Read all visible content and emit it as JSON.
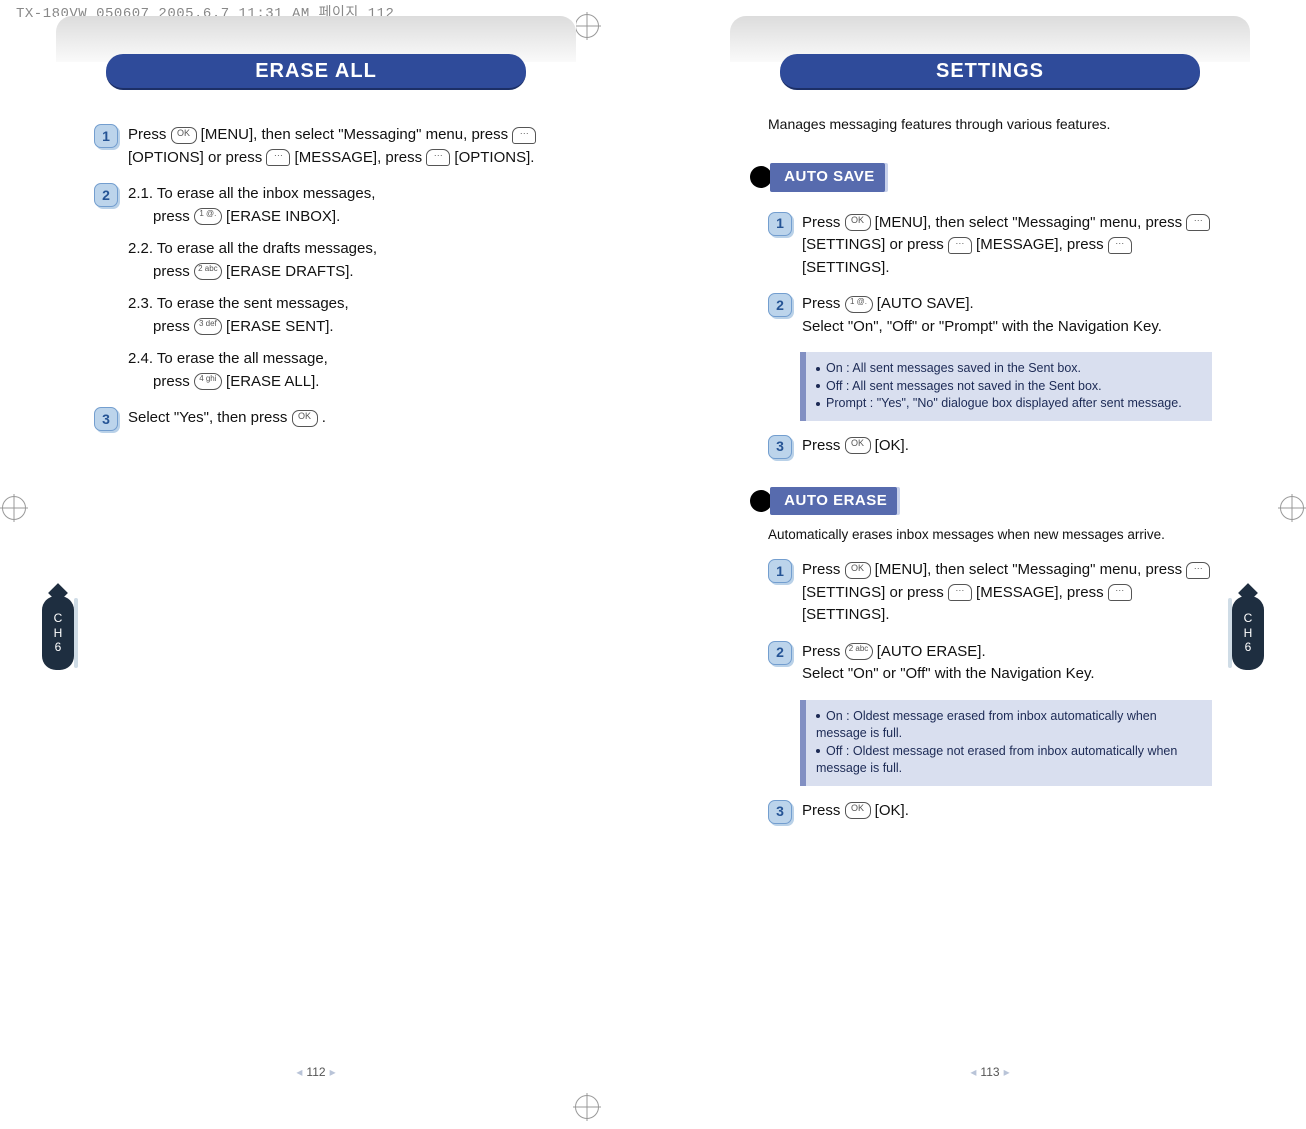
{
  "file_stamp": "TX-180VW_050607  2005.6.7 11:31 AM  페이지 112",
  "left_page": {
    "header_title": "ERASE ALL",
    "steps": {
      "s1": {
        "num": "1",
        "text_a": "Press ",
        "text_b": " [MENU], then select \"Messaging\" menu, press ",
        "text_c": " [OPTIONS] or press ",
        "text_d": " [MESSAGE], press ",
        "text_e": " [OPTIONS]."
      },
      "s2": {
        "num": "2",
        "items": [
          {
            "lead": "2.1. To erase all the inbox messages,",
            "act_a": "press ",
            "act_b": "[ERASE INBOX]."
          },
          {
            "lead": "2.2. To erase all the drafts messages,",
            "act_a": "press ",
            "act_b": "[ERASE DRAFTS]."
          },
          {
            "lead": "2.3. To erase the sent messages,",
            "act_a": "press ",
            "act_b": "[ERASE SENT]."
          },
          {
            "lead": "2.4. To erase the all message,",
            "act_a": "press ",
            "act_b": "[ERASE ALL]."
          }
        ]
      },
      "s3": {
        "num": "3",
        "text_a": "Select \"Yes\", then press ",
        "text_b": " ."
      }
    },
    "side_tab": {
      "line1": "C",
      "line2": "H",
      "line3": "6"
    },
    "page_number": "112"
  },
  "right_page": {
    "header_title": "SETTINGS",
    "lead": "Manages messaging features through various features.",
    "auto_save": {
      "chip": "AUTO SAVE",
      "s1": {
        "num": "1",
        "text_a": "Press ",
        "text_b": " [MENU], then select \"Messaging\" menu, press ",
        "text_c": " [SETTINGS] or press ",
        "text_d": " [MESSAGE], press ",
        "text_e": " [SETTINGS]."
      },
      "s2": {
        "num": "2",
        "text_a": "Press ",
        "text_b": "[AUTO SAVE].",
        "line2": "Select \"On\", \"Off\" or \"Prompt\" with the Navigation Key."
      },
      "note": {
        "l1": "On : All sent messages saved in the Sent box.",
        "l2": "Off : All sent messages not saved in the Sent box.",
        "l3": "Prompt : \"Yes\", \"No\" dialogue box displayed after sent message."
      },
      "s3": {
        "num": "3",
        "text_a": "Press ",
        "text_b": " [OK]."
      }
    },
    "auto_erase": {
      "chip": "AUTO ERASE",
      "sub": "Automatically erases inbox messages when new messages arrive.",
      "s1": {
        "num": "1",
        "text_a": "Press ",
        "text_b": " [MENU], then select \"Messaging\" menu, press ",
        "text_c": " [SETTINGS] or press ",
        "text_d": " [MESSAGE], press ",
        "text_e": " [SETTINGS]."
      },
      "s2": {
        "num": "2",
        "text_a": "Press ",
        "text_b": "[AUTO ERASE].",
        "line2": "Select \"On\" or \"Off\" with the Navigation Key."
      },
      "note": {
        "l1": "On : Oldest message erased from inbox automatically when message is full.",
        "l2": "Off : Oldest message not erased from inbox automatically when message is full."
      },
      "s3": {
        "num": "3",
        "text_a": "Press ",
        "text_b": " [OK]."
      }
    },
    "side_tab": {
      "line1": "C",
      "line2": "H",
      "line3": "6"
    },
    "page_number": "113"
  },
  "icons": {
    "ok": "OK",
    "soft_dots": "···",
    "num1": "1 @.",
    "num2": "2 abc",
    "num3": "3 def",
    "num4": "4 ghi"
  }
}
